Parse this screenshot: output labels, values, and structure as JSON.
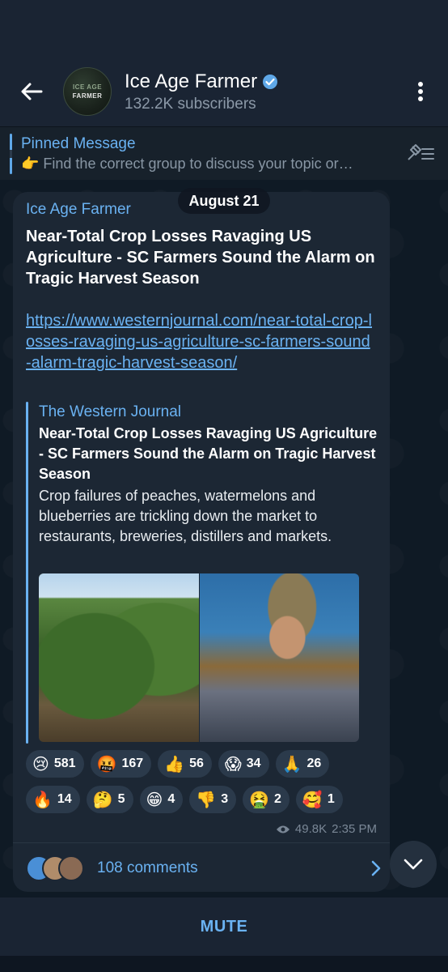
{
  "header": {
    "title": "Ice Age Farmer",
    "subscribers": "132.2K subscribers",
    "avatar_line1": "ICE AGE",
    "avatar_line2": "FARMER",
    "verified_icon": "verified-badge-icon"
  },
  "pinned": {
    "title": "Pinned Message",
    "text": "👉 Find the correct group to discuss your topic or…"
  },
  "message": {
    "date": "August 21",
    "author": "Ice Age Farmer",
    "title": "Near-Total Crop Losses Ravaging US Agriculture - SC Farmers Sound the Alarm on Tragic Harvest Season",
    "link": "https://www.westernjournal.com/near-total-crop-losses-ravaging-us-agriculture-sc-farmers-sound-alarm-tragic-harvest-season/",
    "preview": {
      "site": "The Western Journal",
      "title": "Near-Total Crop Losses Ravaging US Agriculture - SC Farmers Sound the Alarm on Tragic Harvest Season",
      "description": "Crop failures of peaches, watermelons and blueberries are trickling down the market to restaurants, breweries, distillers and markets."
    },
    "reactions_row1": [
      {
        "emoji": "😢",
        "count": "581"
      },
      {
        "emoji": "🤬",
        "count": "167"
      },
      {
        "emoji": "👍",
        "count": "56"
      },
      {
        "emoji": "😱",
        "count": "34"
      },
      {
        "emoji": "🙏",
        "count": "26"
      }
    ],
    "reactions_row2": [
      {
        "emoji": "🔥",
        "count": "14"
      },
      {
        "emoji": "🤔",
        "count": "5"
      },
      {
        "emoji": "😁",
        "count": "4"
      },
      {
        "emoji": "👎",
        "count": "3"
      },
      {
        "emoji": "🤮",
        "count": "2"
      },
      {
        "emoji": "🥰",
        "count": "1"
      }
    ],
    "views": "49.8K",
    "time": "2:35 PM",
    "comments": "108 comments"
  },
  "bottom": {
    "mute_label": "MUTE"
  },
  "colors": {
    "accent": "#6ab2f2",
    "bubble": "#1c2734",
    "header": "#1a2433"
  }
}
